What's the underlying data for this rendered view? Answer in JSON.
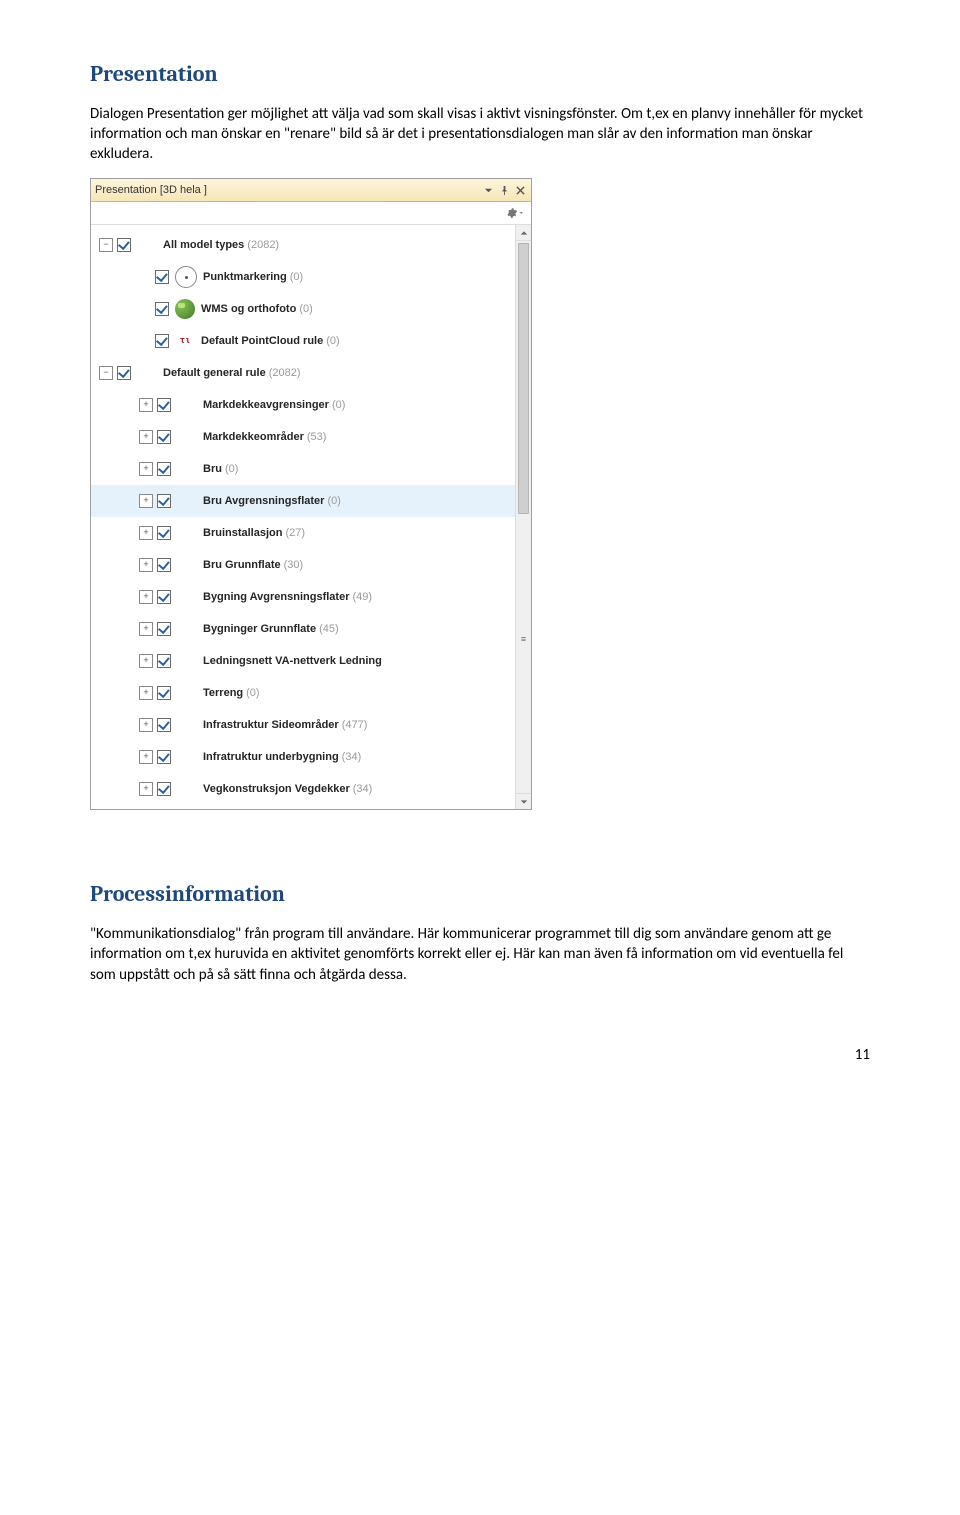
{
  "sections": {
    "presentation": {
      "heading": "Presentation",
      "para1": "Dialogen Presentation ger möjlighet att välja vad som skall visas i aktivt visningsfönster. Om t,ex en planvy innehåller för mycket information och man önskar en \"renare\" bild så är det i presentationsdialogen man slår av den information man önskar exkludera."
    },
    "process": {
      "heading": "Processinformation",
      "para1": "\"Kommunikationsdialog\" från program till användare. Här kommunicerar programmet till dig som användare genom att ge information om t,ex huruvida en aktivitet genomförts korrekt eller ej. Här kan man även få information om vid eventuella fel som uppstått och på så sätt finna och åtgärda dessa."
    }
  },
  "panel": {
    "title": "Presentation [3D hela ]",
    "rows": [
      {
        "indent": 0,
        "toggle": "minus",
        "checked": true,
        "icon": "",
        "label": "All model types",
        "count": "(2082)",
        "selected": false
      },
      {
        "indent": 1,
        "toggle": "blank",
        "checked": true,
        "icon": "dot",
        "label": "Punktmarkering",
        "count": "(0)",
        "selected": false
      },
      {
        "indent": 1,
        "toggle": "blank",
        "checked": true,
        "icon": "globe",
        "label": "WMS og orthofoto",
        "count": "(0)",
        "selected": false
      },
      {
        "indent": 1,
        "toggle": "blank",
        "checked": true,
        "icon": "tau",
        "label": "Default PointCloud rule",
        "count": "(0)",
        "selected": false
      },
      {
        "indent": 0,
        "toggle": "minus",
        "checked": true,
        "icon": "",
        "label": "Default general rule",
        "count": "(2082)",
        "selected": false
      },
      {
        "indent": 1,
        "toggle": "plus",
        "checked": true,
        "icon": "",
        "label": "Markdekkeavgrensinger",
        "count": "(0)",
        "selected": false
      },
      {
        "indent": 1,
        "toggle": "plus",
        "checked": true,
        "icon": "",
        "label": "Markdekkeområder",
        "count": "(53)",
        "selected": false
      },
      {
        "indent": 1,
        "toggle": "plus",
        "checked": true,
        "icon": "",
        "label": "Bru",
        "count": "(0)",
        "selected": false
      },
      {
        "indent": 1,
        "toggle": "plus",
        "checked": true,
        "icon": "",
        "label": "Bru Avgrensningsflater",
        "count": "(0)",
        "selected": true
      },
      {
        "indent": 1,
        "toggle": "plus",
        "checked": true,
        "icon": "",
        "label": "Bruinstallasjon",
        "count": "(27)",
        "selected": false
      },
      {
        "indent": 1,
        "toggle": "plus",
        "checked": true,
        "icon": "",
        "label": "Bru Grunnflate",
        "count": "(30)",
        "selected": false
      },
      {
        "indent": 1,
        "toggle": "plus",
        "checked": true,
        "icon": "",
        "label": "Bygning Avgrensningsflater",
        "count": "(49)",
        "selected": false
      },
      {
        "indent": 1,
        "toggle": "plus",
        "checked": true,
        "icon": "",
        "label": "Bygninger Grunnflate",
        "count": "(45)",
        "selected": false
      },
      {
        "indent": 1,
        "toggle": "plus",
        "checked": true,
        "icon": "",
        "label": "Ledningsnett VA-nettverk Ledning",
        "count": "",
        "selected": false
      },
      {
        "indent": 1,
        "toggle": "plus",
        "checked": true,
        "icon": "",
        "label": "Terreng",
        "count": "(0)",
        "selected": false
      },
      {
        "indent": 1,
        "toggle": "plus",
        "checked": true,
        "icon": "",
        "label": "Infrastruktur Sideområder",
        "count": "(477)",
        "selected": false
      },
      {
        "indent": 1,
        "toggle": "plus",
        "checked": true,
        "icon": "",
        "label": "Infratruktur underbygning",
        "count": "(34)",
        "selected": false
      },
      {
        "indent": 1,
        "toggle": "plus",
        "checked": true,
        "icon": "",
        "label": "Vegkonstruksjon Vegdekker",
        "count": "(34)",
        "selected": false
      }
    ]
  },
  "page_number": "11"
}
